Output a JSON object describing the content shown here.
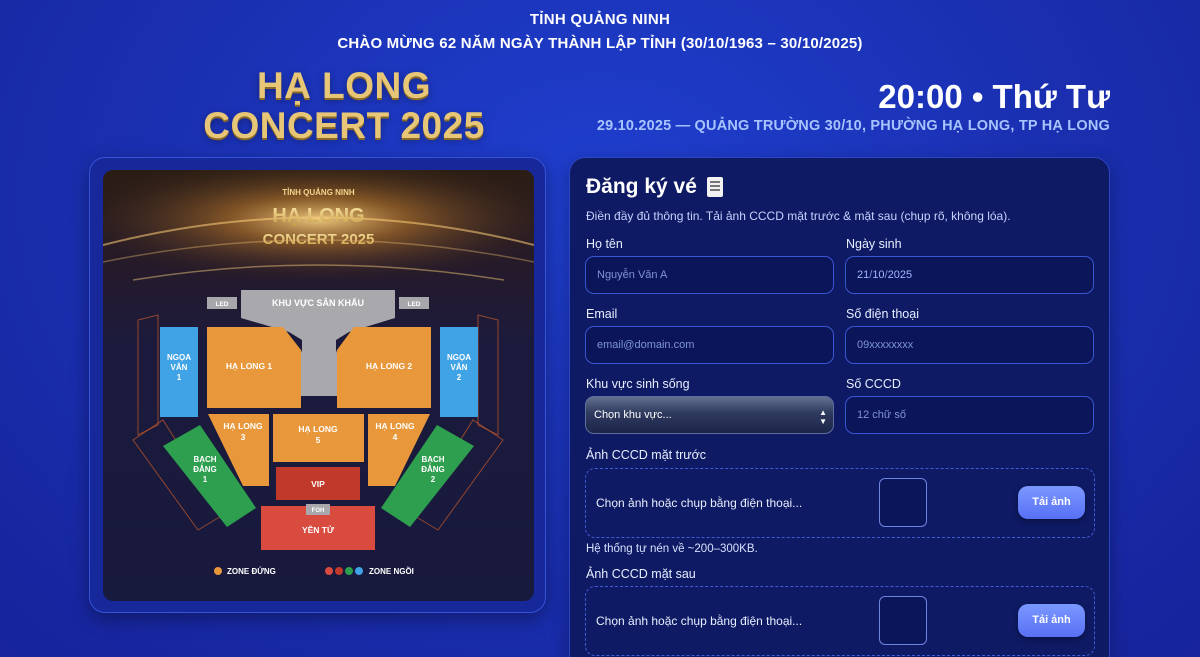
{
  "header": {
    "province": "TỈNH QUẢNG NINH",
    "anniversary": "CHÀO MỪNG 62 NĂM NGÀY THÀNH LẬP TỈNH (30/10/1963 – 30/10/2025)",
    "brand_line1": "HẠ LONG",
    "brand_line2": "CONCERT 2025",
    "time": "20:00 • Thứ Tư",
    "venue": "29.10.2025 — QUẢNG TRƯỜNG 30/10, PHƯỜNG HẠ LONG, TP HẠ LONG"
  },
  "poster": {
    "province": "TỈNH QUẢNG NINH",
    "title1": "HẠ LONG",
    "title2": "CONCERT 2025",
    "led": "LED",
    "stage": "KHU VỰC SÂN KHẤU",
    "zones": {
      "hl1": "HẠ LONG 1",
      "hl2": "HẠ LONG 2",
      "hl3a": "HẠ LONG",
      "hl3b": "3",
      "hl5a": "HẠ LONG",
      "hl5b": "5",
      "hl4a": "HẠ LONG",
      "hl4b": "4",
      "nv1a": "NGỌA",
      "nv1b": "VÂN",
      "nv1c": "1",
      "nv2a": "NGỌA",
      "nv2b": "VÂN",
      "nv2c": "2",
      "bd1a": "BẠCH",
      "bd1b": "ĐẰNG",
      "bd1c": "1",
      "bd2a": "BẠCH",
      "bd2b": "ĐẰNG",
      "bd2c": "2",
      "vip": "VIP",
      "foh": "FOH",
      "yentu": "YÊN TỬ"
    },
    "legend_standing": "ZONE ĐỨNG",
    "legend_seated": "ZONE NGỒI",
    "colors": {
      "standing": "#e8973a",
      "seated": [
        "#d94a3f",
        "#c0392b",
        "#2e9e4f",
        "#3fa3e6"
      ]
    }
  },
  "form": {
    "title": "Đăng ký vé",
    "title_icon": "receipt-icon",
    "subtitle": "Điền đầy đủ thông tin. Tải ảnh CCCD mặt trước & mặt sau (chụp rõ, không lóa).",
    "fullname_label": "Họ tên",
    "fullname_placeholder": "Nguyễn Văn A",
    "dob_label": "Ngày sinh",
    "dob_day": "21",
    "dob_month": "10",
    "dob_year": "2025",
    "email_label": "Email",
    "email_placeholder": "email@domain.com",
    "phone_label": "Số điện thoại",
    "phone_placeholder": "09xxxxxxxx",
    "region_label": "Khu vực sinh sống",
    "region_value": "Chọn khu vực...",
    "id_label": "Số CCCD",
    "id_placeholder": "12 chữ số",
    "front_label": "Ảnh CCCD mặt trước",
    "front_text": "Chọn ảnh hoặc chụp bằng điện thoại...",
    "front_button": "Tải ảnh",
    "hint": "Hệ thống tự nén về ~200–300KB.",
    "back_label": "Ảnh CCCD mặt sau",
    "back_text": "Chọn ảnh hoặc chụp bằng điện thoại...",
    "back_button": "Tải ảnh"
  }
}
